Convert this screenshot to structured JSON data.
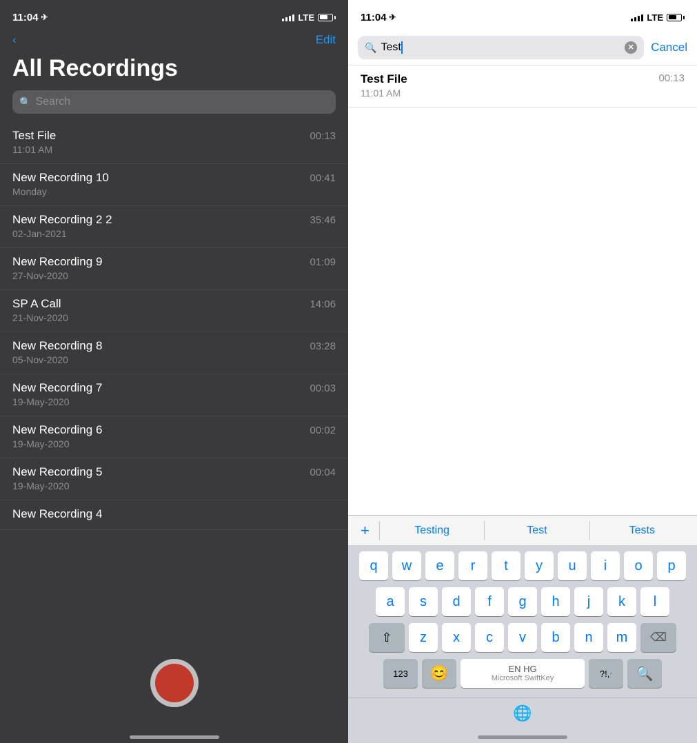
{
  "left": {
    "status_bar": {
      "time": "11:04",
      "location_icon": "▶",
      "lte": "LTE"
    },
    "nav": {
      "back_label": "‹",
      "edit_label": "Edit"
    },
    "title": "All Recordings",
    "search": {
      "placeholder": "Search"
    },
    "recordings": [
      {
        "name": "Test File",
        "date": "11:01 AM",
        "duration": "00:13"
      },
      {
        "name": "New Recording 10",
        "date": "Monday",
        "duration": "00:41"
      },
      {
        "name": "New Recording 2 2",
        "date": "02-Jan-2021",
        "duration": "35:46"
      },
      {
        "name": "New Recording 9",
        "date": "27-Nov-2020",
        "duration": "01:09"
      },
      {
        "name": "SP A Call",
        "date": "21-Nov-2020",
        "duration": "14:06"
      },
      {
        "name": "New Recording 8",
        "date": "05-Nov-2020",
        "duration": "03:28"
      },
      {
        "name": "New Recording 7",
        "date": "19-May-2020",
        "duration": "00:03"
      },
      {
        "name": "New Recording 6",
        "date": "19-May-2020",
        "duration": "00:02"
      },
      {
        "name": "New Recording 5",
        "date": "19-May-2020",
        "duration": "00:04"
      },
      {
        "name": "New Recording 4",
        "date": "",
        "duration": ""
      }
    ]
  },
  "right": {
    "status_bar": {
      "time": "11:04",
      "lte": "LTE"
    },
    "search": {
      "value": "Test",
      "cancel_label": "Cancel"
    },
    "search_results": [
      {
        "name": "Test File",
        "date": "11:01 AM",
        "duration": "00:13"
      }
    ],
    "keyboard": {
      "suggestions": [
        "+",
        "Testing",
        "Test",
        "Tests"
      ],
      "rows": [
        [
          "q",
          "w",
          "e",
          "r",
          "t",
          "y",
          "u",
          "i",
          "o",
          "p"
        ],
        [
          "a",
          "s",
          "d",
          "f",
          "g",
          "h",
          "j",
          "k",
          "l"
        ],
        [
          "z",
          "x",
          "c",
          "v",
          "b",
          "n",
          "m"
        ]
      ],
      "special": {
        "numbers": "123",
        "emoji": "😊",
        "space_lang": "EN HG",
        "space_brand": "Microsoft SwiftKey",
        "punct": "?!,",
        "punct2": ".",
        "shift_icon": "⇧",
        "backspace_icon": "⌫",
        "search_icon": "🔍",
        "globe_icon": "🌐"
      }
    }
  }
}
